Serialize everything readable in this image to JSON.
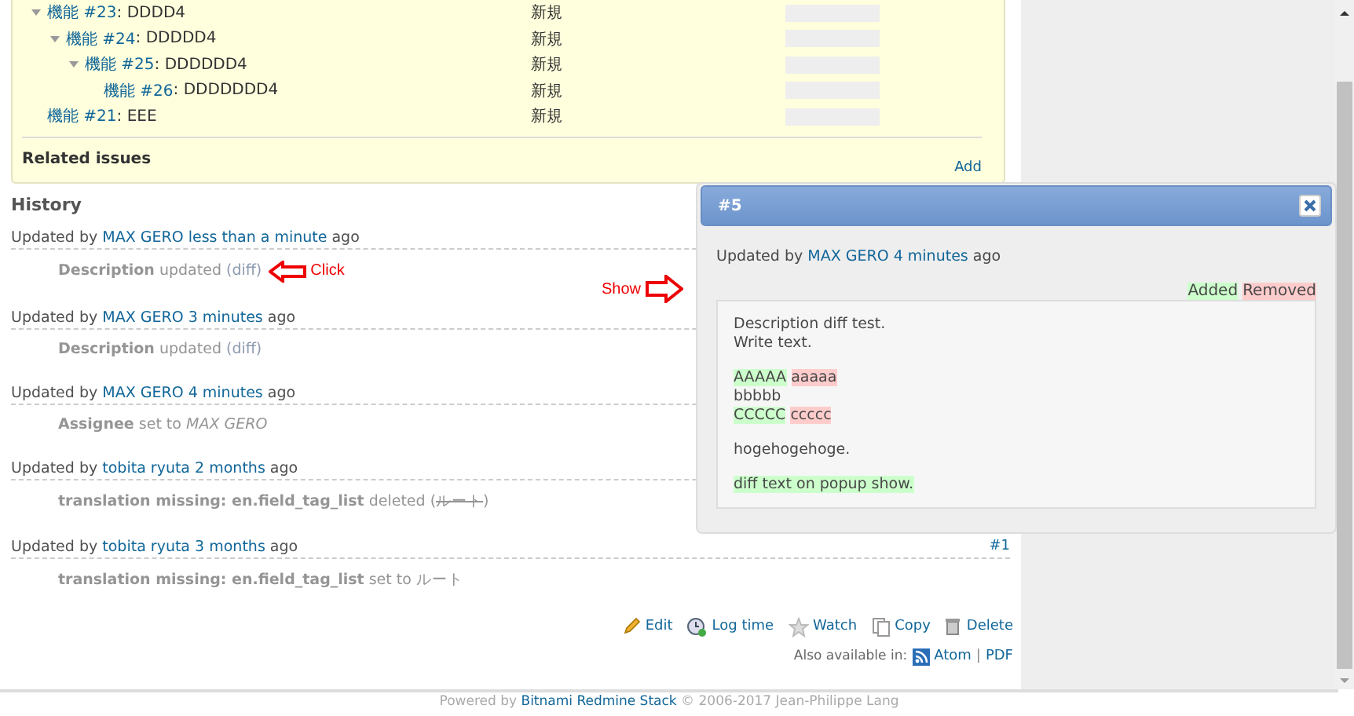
{
  "subtasks": [
    {
      "link": "機能 #23",
      "subject": ": DDDD4",
      "status": "新規",
      "level": 0,
      "expanded": true,
      "children": [
        {
          "link": "機能 #24",
          "subject": ": DDDDD4",
          "status": "新規",
          "level": 0,
          "expanded": true,
          "children": [
            {
              "link": "機能 #25",
              "subject": ": DDDDDD4",
              "status": "新規",
              "level": 0,
              "expanded": true,
              "children": [
                {
                  "link": "機能 #26",
                  "subject": ": DDDDDDD4",
                  "status": "新規",
                  "level": 0
                }
              ]
            }
          ]
        }
      ]
    },
    {
      "link": "機能 #21",
      "subject": ": EEE",
      "status": "新規",
      "level": 0
    }
  ],
  "related_issues": {
    "title": "Related issues",
    "add_link": "Add"
  },
  "history": {
    "title": "History",
    "entries": [
      {
        "prefix": "Updated by",
        "author": "MAX GERO",
        "time": "less than a minute",
        "suffix": "ago",
        "details": [
          {
            "field": "Description",
            "text": "updated",
            "link": "(diff)"
          }
        ]
      },
      {
        "prefix": "Updated by",
        "author": "MAX GERO",
        "time": "3 minutes",
        "suffix": "ago",
        "details": [
          {
            "field": "Description",
            "text": "updated",
            "link": "(diff)"
          }
        ]
      },
      {
        "prefix": "Updated by",
        "author": "MAX GERO",
        "time": "4 minutes",
        "suffix": "ago",
        "details": [
          {
            "field": "Assignee",
            "text": "set to",
            "value": "MAX GERO",
            "kind": "italic"
          }
        ]
      },
      {
        "prefix": "Updated by",
        "author": "tobita ryuta",
        "time": "2 months",
        "suffix": "ago",
        "details": [
          {
            "field": "translation missing: en.field_tag_list",
            "text": "deleted (",
            "value": "ルート",
            "kind": "deleted",
            "after": ")"
          }
        ]
      },
      {
        "prefix": "Updated by",
        "author": "tobita ryuta",
        "time": "3 months",
        "suffix": "ago",
        "number": "#1",
        "details": [
          {
            "field": "translation missing: en.field_tag_list",
            "text": "set to",
            "value": "ルート",
            "kind": "plain"
          }
        ]
      }
    ]
  },
  "annotations": [
    {
      "kind": "left",
      "label": "Click"
    },
    {
      "kind": "right",
      "label": "Show"
    }
  ],
  "actions": [
    {
      "kind": "edit",
      "label": "Edit"
    },
    {
      "kind": "log",
      "label": "Log time"
    },
    {
      "kind": "watch",
      "label": "Watch"
    },
    {
      "kind": "copy",
      "label": "Copy"
    },
    {
      "kind": "delete",
      "label": "Delete"
    }
  ],
  "export": {
    "label": "Also available in:",
    "links": [
      "Atom",
      "PDF"
    ],
    "separator": "|"
  },
  "footer": {
    "prefix": "Powered by",
    "link": "Bitnami Redmine Stack",
    "suffix": "© 2006-2017 Jean-Philippe Lang"
  },
  "popup": {
    "title": "#5",
    "prefix": "Updated by",
    "author": "MAX GERO",
    "time": "4 minutes",
    "suffix": "ago",
    "legend": {
      "added": "Added",
      "removed": "Removed"
    },
    "paragraphs": [
      [
        [
          {
            "kind": "plain",
            "text": "Description diff test."
          }
        ],
        [
          {
            "kind": "plain",
            "text": "Write text."
          }
        ]
      ],
      [
        [
          {
            "kind": "added",
            "text": "AAAAA"
          },
          {
            "kind": "removed",
            "text": "aaaaa"
          }
        ],
        [
          {
            "kind": "plain",
            "text": "bbbbb"
          }
        ],
        [
          {
            "kind": "added",
            "text": "CCCCC"
          },
          {
            "kind": "removed",
            "text": "ccccc"
          }
        ]
      ],
      [
        [
          {
            "kind": "plain",
            "text": "hogehogehoge."
          }
        ]
      ],
      [
        [
          {
            "kind": "added",
            "text": "diff text on popup show."
          }
        ]
      ]
    ]
  }
}
